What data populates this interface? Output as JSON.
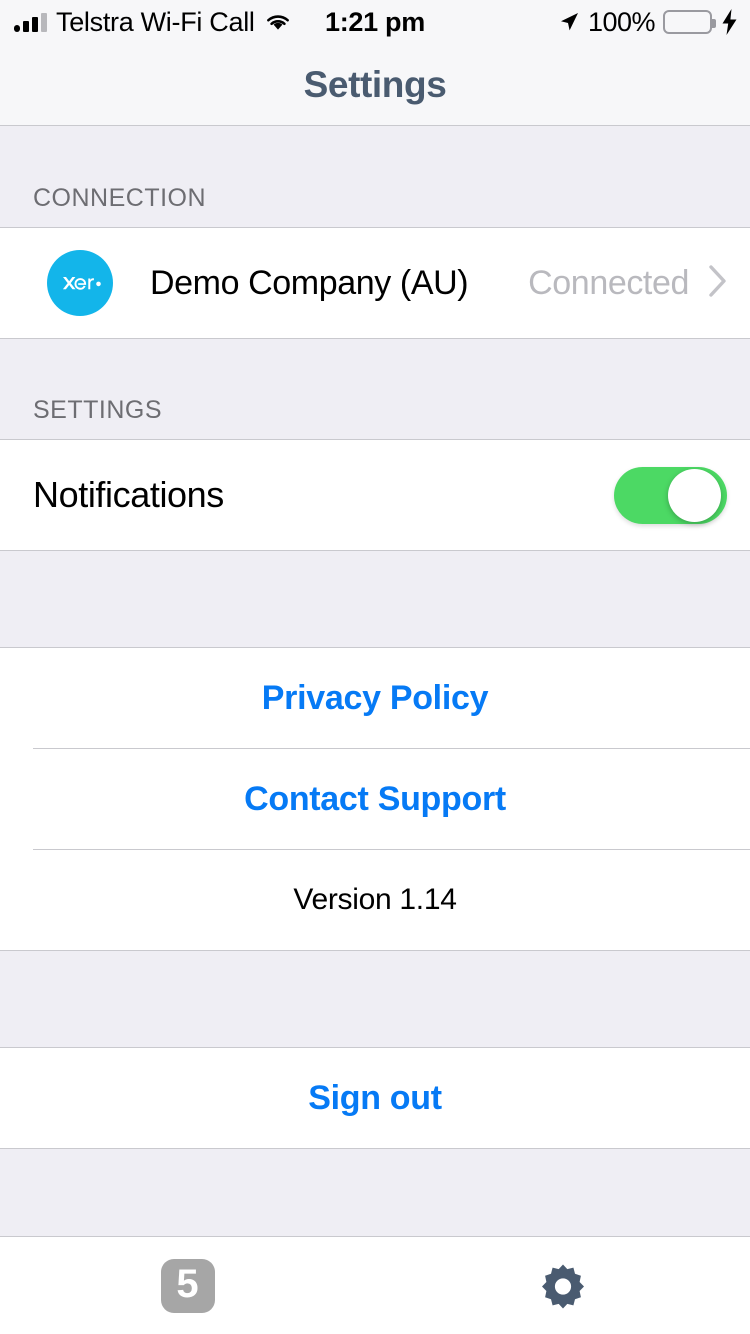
{
  "status_bar": {
    "carrier": "Telstra Wi-Fi Call",
    "time": "1:21 pm",
    "battery_percent": "100%",
    "signal_icon": "signal-bars-icon",
    "wifi_icon": "wifi-icon",
    "location_icon": "location-arrow-icon",
    "battery_icon": "battery-icon",
    "charging_icon": "lightning-bolt-icon",
    "signal_bars_filled": 3,
    "signal_bars_total": 4,
    "battery_color": "#4CD964"
  },
  "nav": {
    "title": "Settings",
    "title_color": "#4A5B70"
  },
  "connection_section": {
    "header": "CONNECTION",
    "row": {
      "logo_text": "xero",
      "logo_color": "#13B5EA",
      "name": "Demo Company (AU)",
      "status": "Connected",
      "chevron_icon": "chevron-right-icon"
    }
  },
  "settings_section": {
    "header": "SETTINGS",
    "notifications": {
      "label": "Notifications",
      "toggle_on": true,
      "toggle_color": "#4CD964"
    }
  },
  "links_section": {
    "privacy_policy": "Privacy Policy",
    "contact_support": "Contact Support",
    "version": "Version 1.14",
    "link_color": "#067AF5"
  },
  "signout_section": {
    "sign_out": "Sign out"
  },
  "tab_bar": {
    "tabs": [
      {
        "name": "inbox-tab",
        "badge": "5",
        "icon": "number-badge-icon",
        "active": false
      },
      {
        "name": "settings-tab",
        "icon": "gear-icon",
        "active": true
      }
    ],
    "active_color": "#4A5B70",
    "inactive_color": "#A6A6A6"
  }
}
